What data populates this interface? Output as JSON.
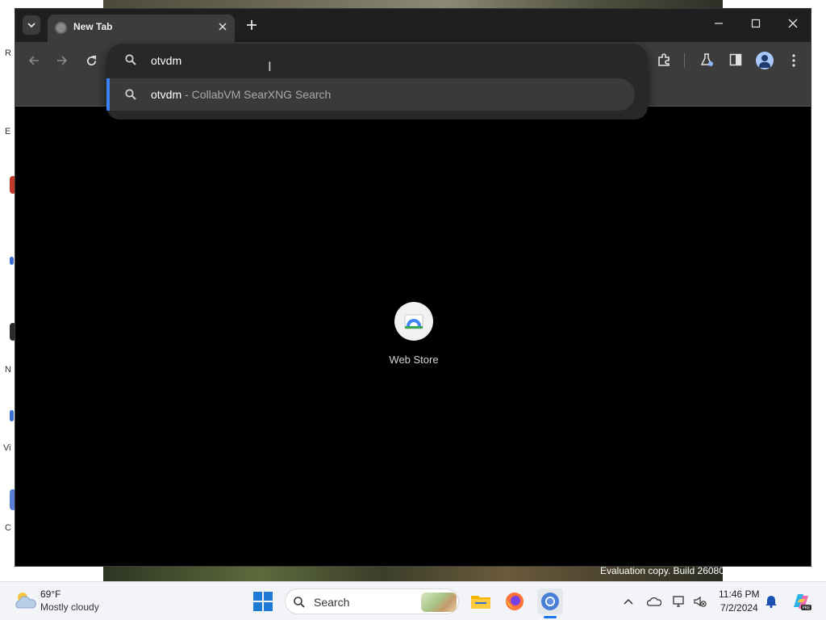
{
  "browser": {
    "tab": {
      "title": "New Tab"
    },
    "window_controls": {
      "minimize": "—",
      "maximize": "☐",
      "close": "✕"
    },
    "nav": {
      "back": "←",
      "forward": "→",
      "reload": "⟳"
    }
  },
  "omnibox": {
    "value": "otvdm",
    "suggestion": {
      "query": "otvdm",
      "separator": " - ",
      "engine": "CollabVM SearXNG Search"
    }
  },
  "ntp": {
    "shortcut": {
      "label": "Web Store"
    }
  },
  "desktop": {
    "watermark": "Evaluation copy. Build 26080.",
    "icon_letters": [
      "R",
      "E",
      "N",
      "Vi",
      "C"
    ]
  },
  "taskbar": {
    "weather": {
      "temp": "69°F",
      "condition": "Mostly cloudy"
    },
    "search_label": "Search",
    "clock": {
      "time": "11:46 PM",
      "date": "7/2/2024"
    }
  },
  "icons": [
    "tab-search-icon",
    "globe-icon",
    "close-icon",
    "plus-icon",
    "back-icon",
    "forward-icon",
    "reload-icon",
    "search-icon",
    "extensions-icon",
    "labs-icon",
    "side-panel-icon",
    "profile-icon",
    "more-icon",
    "web-store-icon",
    "weather-icon",
    "windows-start-icon",
    "file-explorer-icon",
    "firefox-icon",
    "chrome-icon",
    "chevron-up-icon",
    "onedrive-icon",
    "network-icon",
    "volume-muted-icon",
    "bell-icon",
    "copilot-icon"
  ],
  "colors": {
    "accent": "#3b82f6",
    "chrome_dark": "#3c3c3c",
    "omnibox_bg": "#282828",
    "taskbar_bg": "#f2f4f7"
  }
}
